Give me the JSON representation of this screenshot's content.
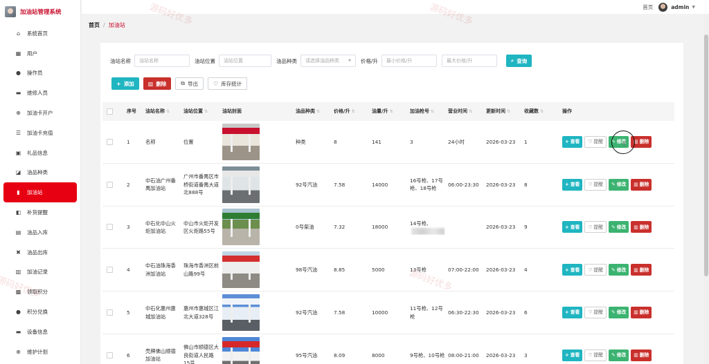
{
  "app": {
    "title": "加油站管理系统"
  },
  "sidebar": {
    "items": [
      {
        "label": "系统首页",
        "icon": "home-icon",
        "glyph": "⌂"
      },
      {
        "label": "用户",
        "icon": "grid-icon",
        "glyph": "▦"
      },
      {
        "label": "操作员",
        "icon": "user-icon",
        "glyph": "●"
      },
      {
        "label": "维修人员",
        "icon": "toolbox-icon",
        "glyph": "▬"
      },
      {
        "label": "加油卡开户",
        "icon": "crosshair-icon",
        "glyph": "⊕"
      },
      {
        "label": "加油卡充值",
        "icon": "sliders-icon",
        "glyph": "☰"
      },
      {
        "label": "礼品信息",
        "icon": "gift-icon",
        "glyph": "▣"
      },
      {
        "label": "油品种类",
        "icon": "chart-icon",
        "glyph": "◪"
      },
      {
        "label": "加油站",
        "icon": "bar-chart-icon",
        "glyph": "▮",
        "active": true
      },
      {
        "label": "补货提醒",
        "icon": "bell-icon",
        "glyph": "◧"
      },
      {
        "label": "油品入库",
        "icon": "inbox-icon",
        "glyph": "▤"
      },
      {
        "label": "油品出库",
        "icon": "shuffle-icon",
        "glyph": "✖"
      },
      {
        "label": "加油记录",
        "icon": "report-icon",
        "glyph": "▥"
      },
      {
        "label": "领取积分",
        "icon": "qrcode-icon",
        "glyph": "▩"
      },
      {
        "label": "积分兑换",
        "icon": "person-icon",
        "glyph": "●"
      },
      {
        "label": "设备信息",
        "icon": "device-icon",
        "glyph": "▬"
      },
      {
        "label": "维护计划",
        "icon": "target-icon",
        "glyph": "⊕"
      }
    ]
  },
  "topbar": {
    "home": "首页",
    "user": "admin"
  },
  "breadcrumb": {
    "home": "首页",
    "separator": "/",
    "current": "加油站"
  },
  "search": {
    "name_label": "油站名称",
    "name_placeholder": "油站名称",
    "location_label": "油站位置",
    "location_placeholder": "油站位置",
    "type_label": "油品种类",
    "type_placeholder": "请选择油品种类",
    "price_label": "价格/升",
    "min_price_placeholder": "最小价格/升",
    "max_price_placeholder": "最大价格/升",
    "button": "查询"
  },
  "actions": {
    "add": "添加",
    "delete": "删除",
    "export": "导出",
    "stock": "库存统计"
  },
  "table": {
    "headers": {
      "idx": "序号",
      "name": "油站名称",
      "location": "油站位置",
      "cover": "油站封面",
      "type": "油品种类",
      "price": "价格/升",
      "qty": "油量/升",
      "guns": "加油枪号",
      "hours": "营业时间",
      "updated": "更新时间",
      "favorites": "收藏数",
      "ops": "操作"
    },
    "rows": [
      {
        "idx": "1",
        "name": "名称",
        "location": "位置",
        "type": "种类",
        "price": "8",
        "qty": "141",
        "guns": "3",
        "hours": "24小时",
        "updated": "2026-03-23",
        "favorites": "1"
      },
      {
        "idx": "2",
        "name": "中石油广州番禺加油站",
        "location": "广州市番禺区市桥街道番禺大道北888号",
        "type": "92号汽油",
        "price": "7.58",
        "qty": "14000",
        "guns": "16号枪、17号枪、18号枪",
        "hours": "06:00-23:30",
        "updated": "2026-03-23",
        "favorites": "8"
      },
      {
        "idx": "3",
        "name": "中石化中山火炬加油站",
        "location": "中山市火炬开发区火炬路55号",
        "type": "0号柴油",
        "price": "7.32",
        "qty": "18000",
        "guns": "14号枪、",
        "hours": "",
        "updated": "2026-03-23",
        "favorites": "9"
      },
      {
        "idx": "4",
        "name": "中石油珠海香洲加油站",
        "location": "珠海市香洲区前山路99号",
        "type": "98号汽油",
        "price": "8.85",
        "qty": "5000",
        "guns": "13号枪",
        "hours": "07:00-22:00",
        "updated": "2026-03-23",
        "favorites": "4"
      },
      {
        "idx": "5",
        "name": "中石化惠州惠城加油站",
        "location": "惠州市惠城区江北大道328号",
        "type": "92号汽油",
        "price": "7.58",
        "qty": "10000",
        "guns": "11号枪、12号枪",
        "hours": "06:30-22:30",
        "updated": "2026-03-23",
        "favorites": "6"
      },
      {
        "idx": "6",
        "name": "壳牌佛山顺德加油站",
        "location": "佛山市顺德区大良街道人民路15号",
        "type": "95号汽油",
        "price": "8.09",
        "qty": "8000",
        "guns": "9号枪、10号枪",
        "hours": "08:00-21:00",
        "updated": "2026-03-23",
        "favorites": "3"
      }
    ],
    "row_actions": {
      "view": "查看",
      "remind": "提醒",
      "edit": "修改",
      "delete": "删除"
    }
  },
  "watermark": "源码好优多",
  "colors": {
    "primary": "#e60012",
    "teal": "#1fb5c1",
    "green": "#3cb371",
    "danger": "#c9302c"
  }
}
